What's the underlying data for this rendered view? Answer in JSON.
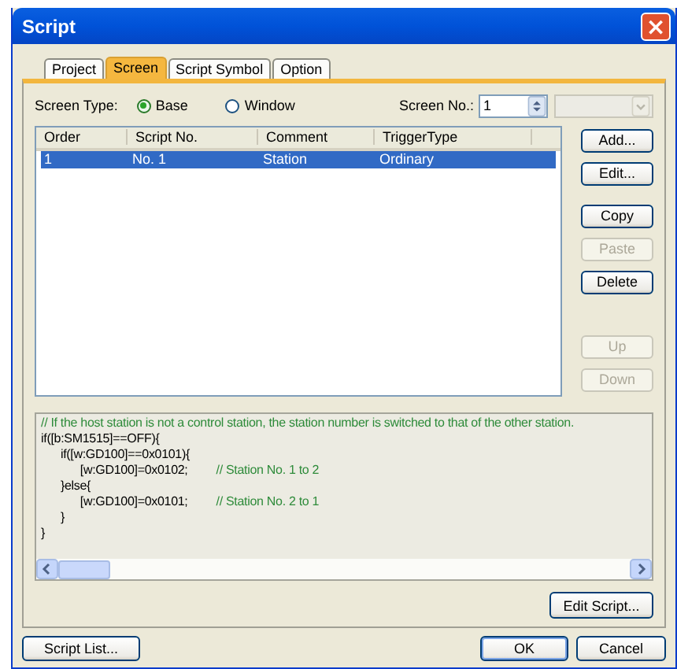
{
  "window": {
    "title": "Script",
    "close": "×"
  },
  "tabs": [
    {
      "label": "Project",
      "selected": false
    },
    {
      "label": "Screen",
      "selected": true
    },
    {
      "label": "Script Symbol",
      "selected": false
    },
    {
      "label": "Option",
      "selected": false
    }
  ],
  "screen_type": {
    "label": "Screen Type:",
    "options": [
      {
        "label": "Base",
        "selected": true
      },
      {
        "label": "Window",
        "selected": false
      }
    ]
  },
  "screen_no": {
    "label": "Screen No.:",
    "value": "1"
  },
  "table": {
    "columns": [
      "Order",
      "Script No.",
      "Comment",
      "TriggerType"
    ],
    "rows": [
      {
        "cells": [
          "1",
          "No. 1",
          "Station",
          "Ordinary"
        ],
        "selected": true
      }
    ]
  },
  "side_buttons": [
    [
      {
        "label": "Add...",
        "disabled": false
      },
      {
        "label": "Edit...",
        "disabled": false
      }
    ],
    [
      {
        "label": "Copy",
        "disabled": false
      },
      {
        "label": "Paste",
        "disabled": true
      },
      {
        "label": "Delete",
        "disabled": false
      }
    ],
    [
      {
        "label": "Up",
        "disabled": true
      },
      {
        "label": "Down",
        "disabled": true
      }
    ]
  ],
  "code": [
    {
      "comment": "// If the host station is not a control station, the station number is switched to that of the other station."
    },
    {
      "code": "if([b:SM1515]==OFF){"
    },
    {
      "code": "\tif([w:GD100]==0x0101){"
    },
    {
      "code": "\t\t[w:GD100]=0x0102;",
      "comment": "// Station No. 1 to 2"
    },
    {
      "code": "\t}else{"
    },
    {
      "code": "\t\t[w:GD100]=0x0101;",
      "comment": "// Station No. 2 to 1"
    },
    {
      "code": "\t}"
    },
    {
      "code": "}"
    }
  ],
  "edit_script": "Edit Script...",
  "bottom_buttons": [
    {
      "label": "Script List...",
      "default": false
    },
    {
      "label": "OK",
      "default": true
    },
    {
      "label": "Cancel",
      "default": false
    }
  ]
}
